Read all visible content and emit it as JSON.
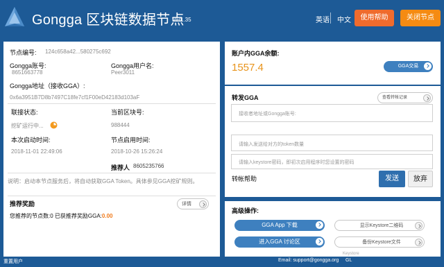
{
  "header": {
    "title": "Gongga 区块链数据节点",
    "version": "Ver1.35",
    "lang_en": "英语",
    "lang_zh": "中文",
    "help_label": "使用帮助",
    "close_label": "关闭节点"
  },
  "node": {
    "id_label": "节点编号:",
    "id_value": "124c658a42...580275c692",
    "account_label": "Gongga账号:",
    "account_value": "8651663778",
    "username_label": "Gongga用户名:",
    "username_value": "Peer3011",
    "address_label": "Gongga地址（接收GGA）:",
    "address_value": "0x6a3951B7D8b7497C18fe7cf1F00eD42183d103aF",
    "link_status_label": "联接状态:",
    "link_status_value": "挖矿运行中...",
    "block_label": "当前区块号:",
    "block_value": "988444",
    "start_time_label": "本次启动时间:",
    "start_time_value": "2018-11-01 22:49:06",
    "enable_time_label": "节点启用时间:",
    "enable_time_value": "2018-10-26 15:26:24",
    "referrer_label": "推荐人",
    "referrer_value": "8605235766",
    "note": "说明：启动本节点服务后，将自动获取GGA Token。具体参见GGA挖矿规则。"
  },
  "reward": {
    "title": "推荐奖励",
    "detail_label": "详情",
    "text": "您推荐的节点数:0  已获推荐奖励GGA:",
    "amount": "0.00"
  },
  "balance": {
    "label": "账户内GGA余额:",
    "value": "1557.4",
    "trade_label": "GGA交易"
  },
  "transfer": {
    "title": "转发GGA",
    "records_label": "查看转帐记录",
    "recipient_placeholder": "接收者地址或Gongga账号:",
    "amount_placeholder": "请输入发送给对方的token数量",
    "password_placeholder": "请输入keystore密码，即初次启用程序时您设置的密码",
    "help_label": "转帐帮助",
    "send_label": "发送",
    "cancel_label": "放弃"
  },
  "advanced": {
    "title": "高级操作:",
    "download_label": "GGA App 下载",
    "qrcode_label": "显示Keystore二维码",
    "forum_label": "进入GGA 讨论区",
    "backup_label": "备份Keystore文件",
    "keystore_label": "Keystore"
  },
  "footer": {
    "reset_label": "重置用户",
    "email": "Email: support@gongga.org",
    "gl": "GL"
  },
  "colors": {
    "brand_blue": "#1d5a96",
    "orange": "#ef6b2d",
    "amber": "#f58b12",
    "balance_orange": "#e8931a",
    "reward_orange": "#f07a1a"
  }
}
